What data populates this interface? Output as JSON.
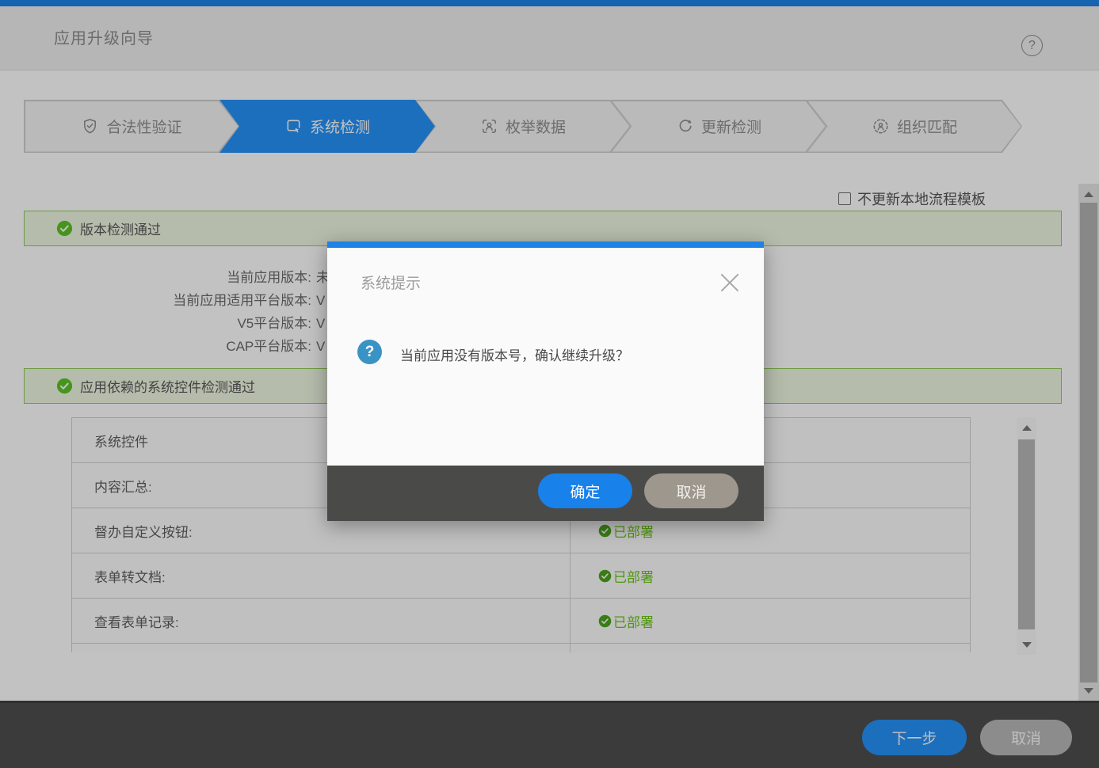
{
  "header": {
    "title": "应用升级向导"
  },
  "steps": [
    {
      "label": "合法性验证",
      "icon": "shield-check-icon",
      "active": false
    },
    {
      "label": "系统检测",
      "icon": "monitor-click-icon",
      "active": true
    },
    {
      "label": "枚举数据",
      "icon": "face-scan-icon",
      "active": false
    },
    {
      "label": "更新检测",
      "icon": "refresh-icon",
      "active": false
    },
    {
      "label": "组织匹配",
      "icon": "org-match-icon",
      "active": false
    }
  ],
  "content": {
    "checkbox_label": "不更新本地流程模板",
    "checkbox_checked": false,
    "banners": [
      {
        "text": "版本检测通过"
      },
      {
        "text": "应用依赖的系统控件检测通过"
      }
    ],
    "version_rows": [
      {
        "label": "当前应用版本:",
        "value": "未"
      },
      {
        "label": "当前应用适用平台版本:",
        "value": "V"
      },
      {
        "label": "V5平台版本:",
        "value": "V"
      },
      {
        "label": "CAP平台版本:",
        "value": "V"
      }
    ],
    "table": {
      "rows": [
        {
          "label": "系统控件",
          "status": ""
        },
        {
          "label": "内容汇总:",
          "status": ""
        },
        {
          "label": "督办自定义按钮:",
          "status": "已部署"
        },
        {
          "label": "表单转文档:",
          "status": "已部署"
        },
        {
          "label": "查看表单记录:",
          "status": "已部署"
        }
      ]
    }
  },
  "dialog": {
    "title": "系统提示",
    "message": "当前应用没有版本号，确认继续升级？",
    "ok_label": "确定",
    "cancel_label": "取消"
  },
  "footer": {
    "next_label": "下一步",
    "cancel_label": "取消"
  },
  "colors": {
    "accent_blue": "#1e82e6",
    "active_step_blue": "#2593f7",
    "success_green": "#5bc426",
    "deployed_text_green": "#67c615",
    "banner_bg": "#eef7e2",
    "banner_border": "#92cc58",
    "dialog_footer": "#4a4a49",
    "page_footer": "#4e4e4e"
  }
}
